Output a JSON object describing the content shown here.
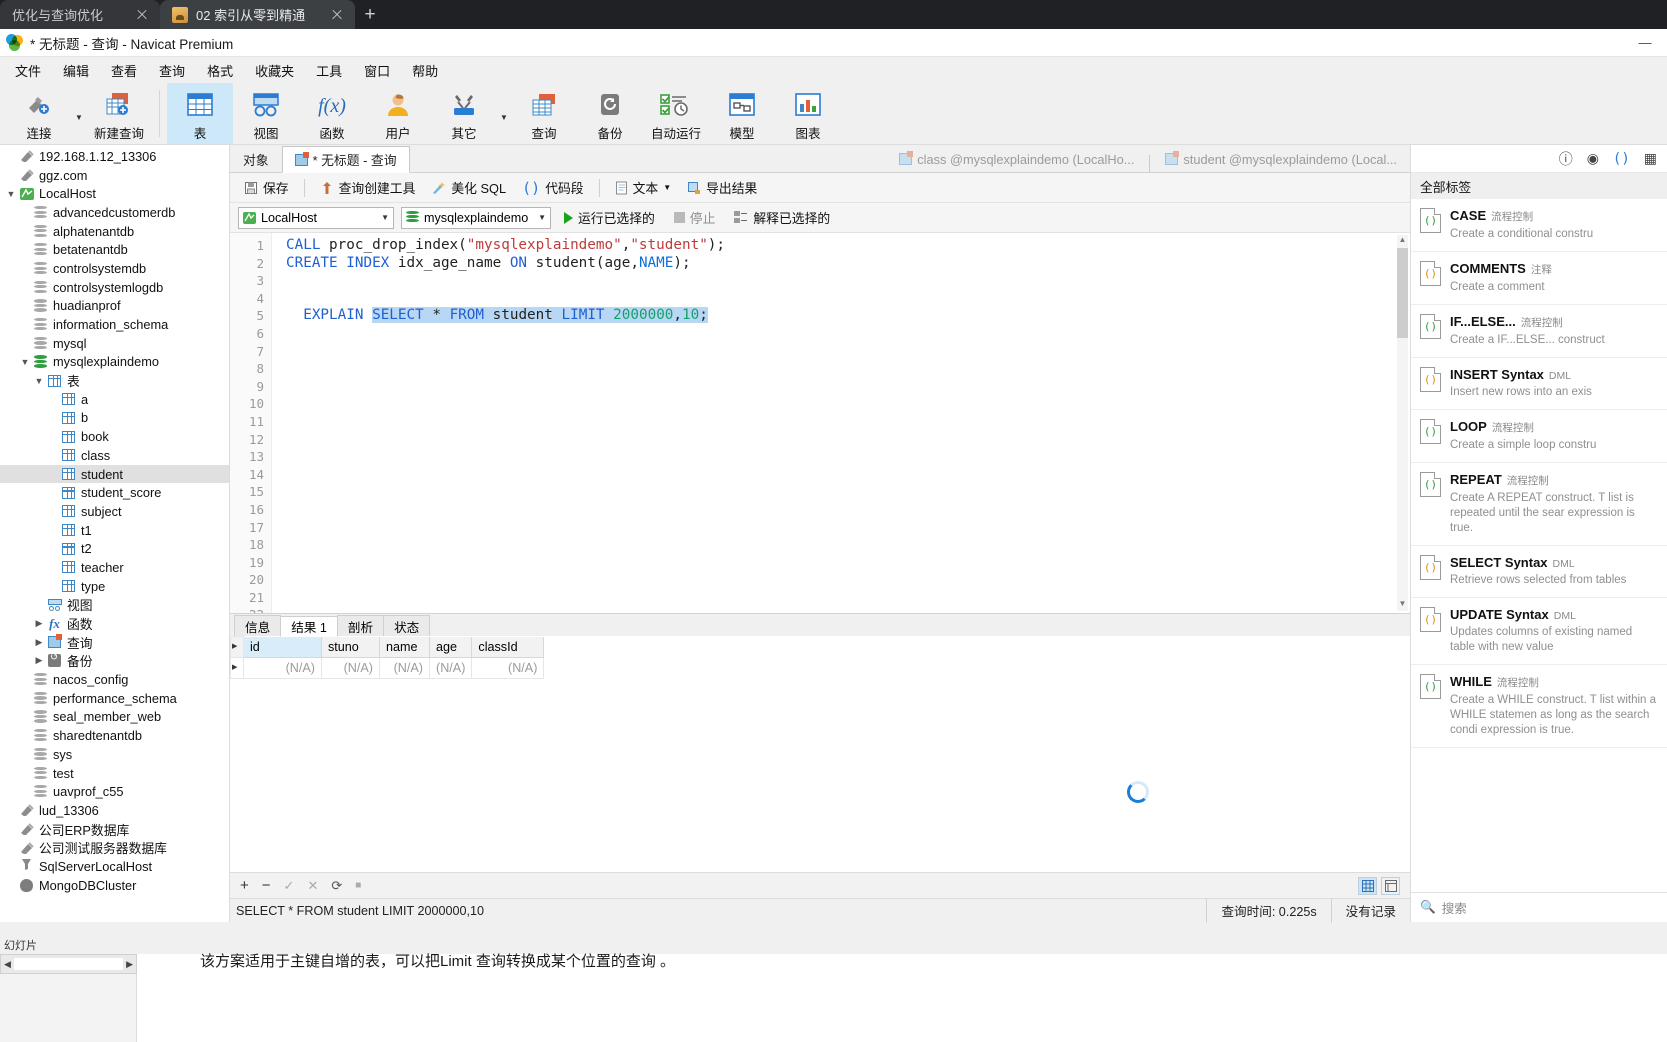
{
  "browser": {
    "tabs": [
      {
        "title": "优化与查询优化",
        "active": false
      },
      {
        "title": "02 索引从零到精通",
        "active": true
      }
    ],
    "new_tab_label": "+"
  },
  "window": {
    "title": "* 无标题 - 查询 - Navicat Premium",
    "minimize": "—"
  },
  "menu": [
    "文件",
    "编辑",
    "查看",
    "查询",
    "格式",
    "收藏夹",
    "工具",
    "窗口",
    "帮助"
  ],
  "ribbon": [
    {
      "label": "连接",
      "icon": "connection-icon",
      "caret": true
    },
    {
      "label": "新建查询",
      "icon": "new-query-icon"
    },
    {
      "label": "表",
      "icon": "table-icon",
      "selected": true
    },
    {
      "label": "视图",
      "icon": "view-icon"
    },
    {
      "label": "函数",
      "icon": "function-icon"
    },
    {
      "label": "用户",
      "icon": "user-icon"
    },
    {
      "label": "其它",
      "icon": "other-tools-icon",
      "caret": true
    },
    {
      "label": "查询",
      "icon": "query-icon"
    },
    {
      "label": "备份",
      "icon": "backup-icon"
    },
    {
      "label": "自动运行",
      "icon": "automation-icon"
    },
    {
      "label": "模型",
      "icon": "model-icon"
    },
    {
      "label": "图表",
      "icon": "chart-icon"
    }
  ],
  "sidebar": [
    {
      "label": "192.168.1.12_13306",
      "depth": 0,
      "icon": "connection-icon",
      "twisty": ""
    },
    {
      "label": "ggz.com",
      "depth": 0,
      "icon": "connection-icon",
      "twisty": ""
    },
    {
      "label": "LocalHost",
      "depth": 0,
      "icon": "connection-green-icon",
      "twisty": "v"
    },
    {
      "label": "advancedcustomerdb",
      "depth": 1,
      "icon": "database-icon",
      "twisty": ""
    },
    {
      "label": "alphatenantdb",
      "depth": 1,
      "icon": "database-icon",
      "twisty": ""
    },
    {
      "label": "betatenantdb",
      "depth": 1,
      "icon": "database-icon",
      "twisty": ""
    },
    {
      "label": "controlsystemdb",
      "depth": 1,
      "icon": "database-icon",
      "twisty": ""
    },
    {
      "label": "controlsystemlogdb",
      "depth": 1,
      "icon": "database-icon",
      "twisty": ""
    },
    {
      "label": "huadianprof",
      "depth": 1,
      "icon": "database-icon",
      "twisty": ""
    },
    {
      "label": "information_schema",
      "depth": 1,
      "icon": "database-icon",
      "twisty": ""
    },
    {
      "label": "mysql",
      "depth": 1,
      "icon": "database-icon",
      "twisty": ""
    },
    {
      "label": "mysqlexplaindemo",
      "depth": 1,
      "icon": "database-open-icon",
      "twisty": "v"
    },
    {
      "label": "表",
      "depth": 2,
      "icon": "tables-folder-icon",
      "twisty": "v"
    },
    {
      "label": "a",
      "depth": 3,
      "icon": "table-icon",
      "twisty": ""
    },
    {
      "label": "b",
      "depth": 3,
      "icon": "table-icon",
      "twisty": ""
    },
    {
      "label": "book",
      "depth": 3,
      "icon": "table-icon",
      "twisty": ""
    },
    {
      "label": "class",
      "depth": 3,
      "icon": "table-icon",
      "twisty": ""
    },
    {
      "label": "student",
      "depth": 3,
      "icon": "table-icon",
      "twisty": "",
      "selected": true
    },
    {
      "label": "student_score",
      "depth": 3,
      "icon": "table-icon",
      "twisty": ""
    },
    {
      "label": "subject",
      "depth": 3,
      "icon": "table-icon",
      "twisty": ""
    },
    {
      "label": "t1",
      "depth": 3,
      "icon": "table-icon",
      "twisty": ""
    },
    {
      "label": "t2",
      "depth": 3,
      "icon": "table-icon",
      "twisty": ""
    },
    {
      "label": "teacher",
      "depth": 3,
      "icon": "table-icon",
      "twisty": ""
    },
    {
      "label": "type",
      "depth": 3,
      "icon": "table-icon",
      "twisty": ""
    },
    {
      "label": "视图",
      "depth": 2,
      "icon": "views-folder-icon",
      "twisty": ""
    },
    {
      "label": "函数",
      "depth": 2,
      "icon": "functions-folder-icon",
      "twisty": ">"
    },
    {
      "label": "查询",
      "depth": 2,
      "icon": "queries-folder-icon",
      "twisty": ">"
    },
    {
      "label": "备份",
      "depth": 2,
      "icon": "backups-folder-icon",
      "twisty": ">"
    },
    {
      "label": "nacos_config",
      "depth": 1,
      "icon": "database-icon",
      "twisty": ""
    },
    {
      "label": "performance_schema",
      "depth": 1,
      "icon": "database-icon",
      "twisty": ""
    },
    {
      "label": "seal_member_web",
      "depth": 1,
      "icon": "database-icon",
      "twisty": ""
    },
    {
      "label": "sharedtenantdb",
      "depth": 1,
      "icon": "database-icon",
      "twisty": ""
    },
    {
      "label": "sys",
      "depth": 1,
      "icon": "database-icon",
      "twisty": ""
    },
    {
      "label": "test",
      "depth": 1,
      "icon": "database-icon",
      "twisty": ""
    },
    {
      "label": "uavprof_c55",
      "depth": 1,
      "icon": "database-icon",
      "twisty": ""
    },
    {
      "label": "lud_13306",
      "depth": 0,
      "icon": "connection-icon",
      "twisty": ""
    },
    {
      "label": "公司ERP数据库",
      "depth": 0,
      "icon": "connection-icon",
      "twisty": ""
    },
    {
      "label": "公司测试服务器数据库",
      "depth": 0,
      "icon": "connection-icon",
      "twisty": ""
    },
    {
      "label": "SqlServerLocalHost",
      "depth": 0,
      "icon": "sqlserver-icon",
      "twisty": ""
    },
    {
      "label": "MongoDBCluster",
      "depth": 0,
      "icon": "mongodb-icon",
      "twisty": ""
    }
  ],
  "object_tabs": [
    {
      "label": "对象",
      "state": "plain"
    },
    {
      "label": "* 无标题 - 查询",
      "state": "active"
    },
    {
      "label": "class @mysqlexplaindemo (LocalHo...",
      "state": "ghost"
    },
    {
      "label": "student @mysqlexplaindemo (Local...",
      "state": "ghost"
    }
  ],
  "query_toolbar": {
    "save": "保存",
    "query_builder": "查询创建工具",
    "beautify_sql": "美化 SQL",
    "snippet": "代码段",
    "text": "文本",
    "export_result": "导出结果"
  },
  "conn_bar": {
    "connection": "LocalHost",
    "database": "mysqlexplaindemo",
    "run_selected": "运行已选择的",
    "stop": "停止",
    "explain_selected": "解释已选择的"
  },
  "editor": {
    "line_count": 23,
    "lines": [
      {
        "n": 1,
        "tokens": [
          {
            "t": "CALL ",
            "c": "kw"
          },
          {
            "t": "proc_drop_index(",
            "c": "pln"
          },
          {
            "t": "\"mysqlexplaindemo\"",
            "c": "str"
          },
          {
            "t": ",",
            "c": "pln"
          },
          {
            "t": "\"student\"",
            "c": "str"
          },
          {
            "t": ");",
            "c": "pln"
          }
        ]
      },
      {
        "n": 2,
        "tokens": [
          {
            "t": "CREATE INDEX ",
            "c": "kw"
          },
          {
            "t": "idx_age_name ",
            "c": "pln"
          },
          {
            "t": "ON ",
            "c": "kw"
          },
          {
            "t": "student(age,",
            "c": "pln"
          },
          {
            "t": "NAME",
            "c": "kw2"
          },
          {
            "t": ");",
            "c": "pln"
          }
        ]
      },
      {
        "n": 3,
        "tokens": []
      },
      {
        "n": 4,
        "tokens": []
      },
      {
        "n": 5,
        "indent": 1,
        "tokens": [
          {
            "t": "EXPLAIN ",
            "c": "kw"
          },
          {
            "t": "SELECT ",
            "c": "kw",
            "sel": true
          },
          {
            "t": "* ",
            "c": "pln",
            "sel": true
          },
          {
            "t": "FROM ",
            "c": "kw",
            "sel": true
          },
          {
            "t": "student ",
            "c": "pln",
            "sel": true
          },
          {
            "t": "LIMIT ",
            "c": "kw",
            "sel": true
          },
          {
            "t": "2000000",
            "c": "num",
            "sel": true
          },
          {
            "t": ",",
            "c": "pln",
            "sel": true
          },
          {
            "t": "10",
            "c": "num",
            "sel": true
          },
          {
            "t": ";",
            "c": "pln",
            "sel": true
          }
        ]
      }
    ]
  },
  "result_tabs": [
    {
      "label": "信息",
      "active": false
    },
    {
      "label": "结果 1",
      "active": true
    },
    {
      "label": "剖析",
      "active": false
    },
    {
      "label": "状态",
      "active": false
    }
  ],
  "grid": {
    "columns": [
      "id",
      "stuno",
      "name",
      "age",
      "classId"
    ],
    "rows": [
      [
        "(N/A)",
        "(N/A)",
        "(N/A)",
        "(N/A)",
        "(N/A)"
      ]
    ],
    "loading": true
  },
  "grid_footer": {
    "add": "+",
    "remove": "−",
    "apply": "✓",
    "cancel": "✕",
    "refresh": "⟳",
    "stop": "■"
  },
  "right_panel": {
    "icons": [
      "info-icon",
      "eye-icon",
      "snippet-icon",
      "grid-icon"
    ],
    "title": "全部标签",
    "search_placeholder": "搜索",
    "snippets": [
      {
        "name": "CASE",
        "tag": "流程控制",
        "desc": "Create a conditional constru",
        "color": "green"
      },
      {
        "name": "COMMENTS",
        "tag": "注释",
        "desc": "Create a comment",
        "color": "orange"
      },
      {
        "name": "IF...ELSE...",
        "tag": "流程控制",
        "desc": "Create a IF...ELSE... construct",
        "color": "green"
      },
      {
        "name": "INSERT Syntax",
        "tag": "DML",
        "desc": "Insert new rows into an exis",
        "color": "orange"
      },
      {
        "name": "LOOP",
        "tag": "流程控制",
        "desc": "Create a simple loop constru",
        "color": "green"
      },
      {
        "name": "REPEAT",
        "tag": "流程控制",
        "desc": "Create A REPEAT construct. T list is repeated until the sear expression is true.",
        "color": "green"
      },
      {
        "name": "SELECT Syntax",
        "tag": "DML",
        "desc": "Retrieve rows selected from tables",
        "color": "orange"
      },
      {
        "name": "UPDATE Syntax",
        "tag": "DML",
        "desc": "Updates columns of existing named table with new value",
        "color": "orange"
      },
      {
        "name": "WHILE",
        "tag": "流程控制",
        "desc": "Create a WHILE construct. T list within a WHILE statemen as long as the search condi expression is true.",
        "color": "green"
      }
    ]
  },
  "status_bar": {
    "sql": "SELECT * FROM student LIMIT 2000000,10",
    "query_time": "查询时间: 0.225s",
    "records": "没有记录"
  },
  "bottom_note": "该方案适用于主键自增的表，可以把Limit 查询转换成某个位置的查询 。",
  "bottom_left_caption": "幻灯片"
}
